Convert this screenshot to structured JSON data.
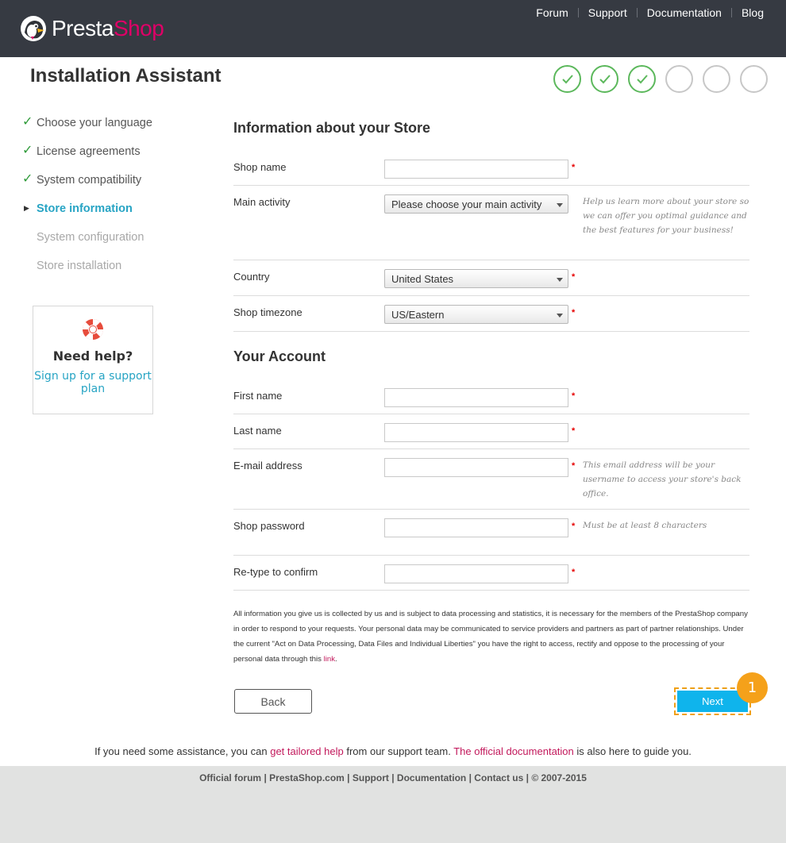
{
  "header": {
    "logo": {
      "part1": "Presta",
      "part2": "Shop",
      "brand_color": "#df0067"
    },
    "nav": [
      "Forum",
      "Support",
      "Documentation",
      "Blog"
    ],
    "bg_color": "#363a42"
  },
  "page_title": "Installation Assistant",
  "steps_progress": [
    "done",
    "done",
    "done",
    "todo",
    "todo",
    "todo"
  ],
  "sidebar": {
    "steps": [
      {
        "label": "Choose your language",
        "state": "done"
      },
      {
        "label": "License agreements",
        "state": "done"
      },
      {
        "label": "System compatibility",
        "state": "done"
      },
      {
        "label": "Store information",
        "state": "current"
      },
      {
        "label": "System configuration",
        "state": "todo"
      },
      {
        "label": "Store installation",
        "state": "todo"
      }
    ],
    "help": {
      "icon": "lifebuoy-icon",
      "title": "Need help?",
      "link": "Sign up for a support plan"
    }
  },
  "store": {
    "title": "Information about your Store",
    "shop_name": {
      "label": "Shop name",
      "value": ""
    },
    "main_activity": {
      "label": "Main activity",
      "value": "Please choose your main activity",
      "hint": "Help us learn more about your store so we can offer you optimal guidance and the best features for your business!"
    },
    "country": {
      "label": "Country",
      "value": "United States"
    },
    "timezone": {
      "label": "Shop timezone",
      "value": "US/Eastern"
    }
  },
  "account": {
    "title": "Your Account",
    "first_name": {
      "label": "First name",
      "value": ""
    },
    "last_name": {
      "label": "Last name",
      "value": ""
    },
    "email": {
      "label": "E-mail address",
      "value": "",
      "hint": "This email address will be your username to access your store's back office."
    },
    "password": {
      "label": "Shop password",
      "value": "",
      "hint": "Must be at least 8 characters"
    },
    "retype": {
      "label": "Re-type to confirm",
      "value": ""
    }
  },
  "required_marker": "*",
  "privacy": {
    "text": "All information you give us is collected by us and is subject to data processing and statistics, it is necessary for the members of the PrestaShop company in order to respond to your requests. Your personal data may be communicated to service providers and partners as part of partner relationships. Under the current \"Act on Data Processing, Data Files and Individual Liberties\" you have the right to access, rectify and oppose to the processing of your personal data through this ",
    "link": "link",
    "end": "."
  },
  "buttons": {
    "back": "Back",
    "next": "Next"
  },
  "annotation_badge": "1",
  "assistance": {
    "t1": "If you need some assistance, you can ",
    "link1": "get tailored help",
    "t2": " from our support team. ",
    "link2": "The official documentation",
    "t3": " is also here to guide you."
  },
  "footer": {
    "links": [
      "Official forum",
      "PrestaShop.com",
      "Support",
      "Documentation",
      "Contact us"
    ],
    "copyright": "© 2007-2015",
    "separator": " | "
  },
  "colors": {
    "accent_blue": "#27a4c4",
    "next_button": "#0fb4ec",
    "check_green": "#2f9b3a",
    "link_pink": "#c2185b",
    "badge_orange": "#f5a11a"
  }
}
